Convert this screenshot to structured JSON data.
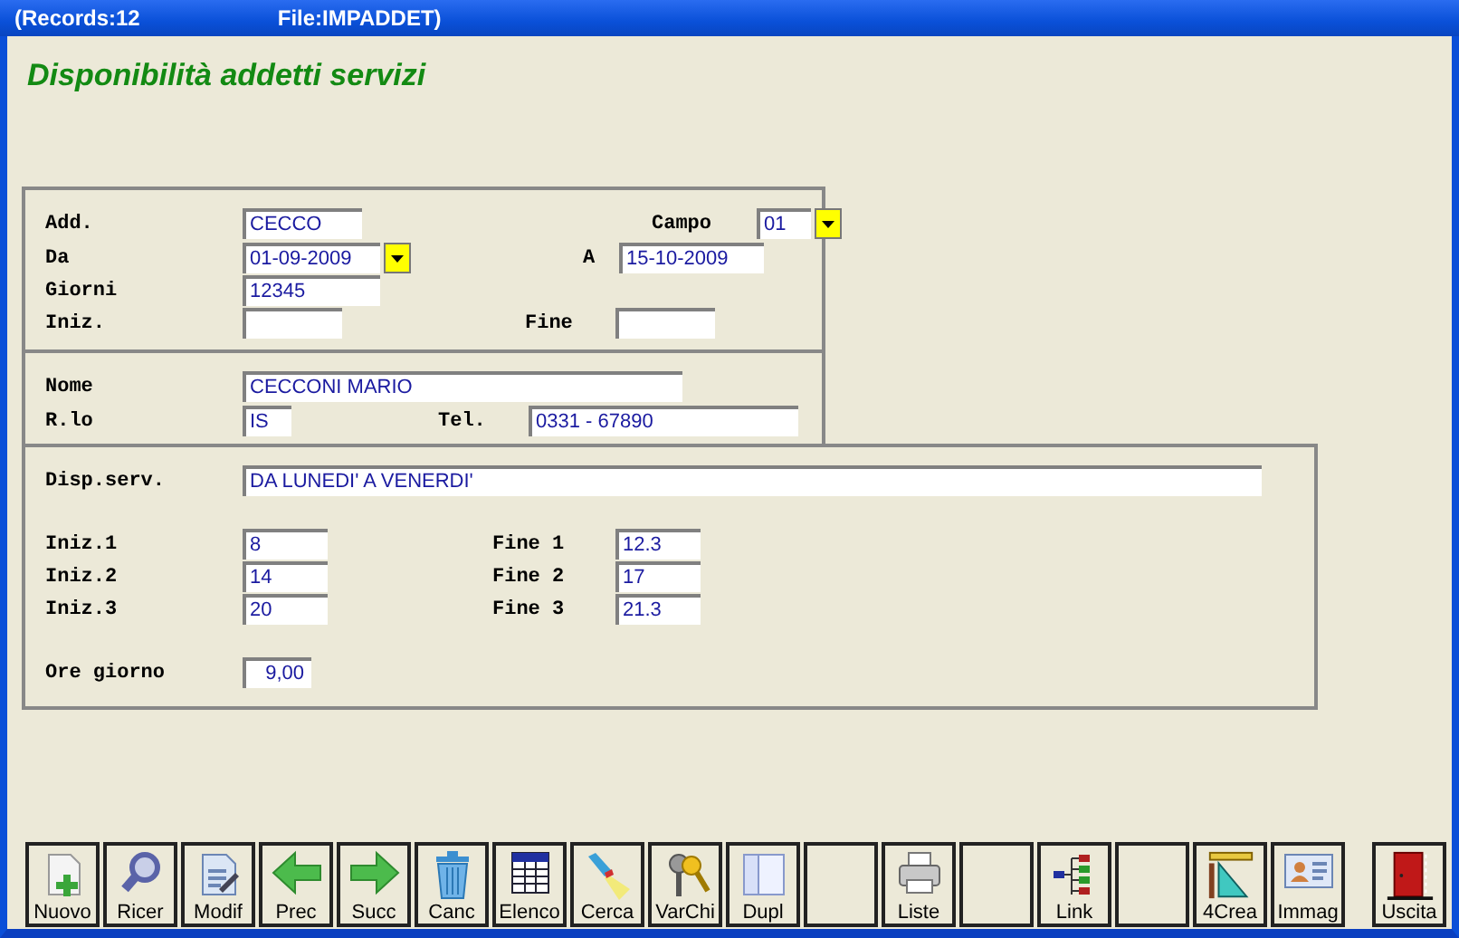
{
  "title_bar": {
    "records": "(Records:12",
    "file": "File:IMPADDET)"
  },
  "form_title": "Disponibilità addetti servizi",
  "panels": [
    {
      "rows": [
        [
          {
            "label": "Add.",
            "value": "CECCO",
            "dropdown": false
          },
          {
            "label": "Campo",
            "value": "01",
            "dropdown": true
          }
        ],
        [
          {
            "label": "Da",
            "value": "01-09-2009",
            "dropdown": true
          },
          {
            "label": "A",
            "value": "15-10-2009",
            "dropdown": false
          }
        ],
        [
          {
            "label": "Giorni",
            "value": "12345",
            "dropdown": false
          }
        ],
        [
          {
            "label": "Iniz.",
            "dropdown": false
          },
          {
            "label": "Fine",
            "dropdown": false
          }
        ]
      ]
    },
    {
      "rows": [
        [
          {
            "label": "Nome",
            "value": "CECCONI MARIO",
            "dropdown": false
          }
        ],
        [
          {
            "label": "R.lo",
            "value": "IS",
            "dropdown": false
          },
          {
            "label": "Tel.",
            "value": "0331 - 67890",
            "dropdown": false
          }
        ]
      ]
    },
    {
      "rows": [
        [
          {
            "label": "Disp.serv.",
            "value": "DA LUNEDI' A VENERDI'",
            "dropdown": false
          }
        ],
        [
          {
            "label": "Iniz.1",
            "value": "8",
            "dropdown": false
          },
          {
            "label": "Fine 1",
            "value": "12.3",
            "dropdown": false
          }
        ],
        [
          {
            "label": "Iniz.2",
            "value": "14",
            "dropdown": false
          },
          {
            "label": "Fine 2",
            "value": "17",
            "dropdown": false
          }
        ],
        [
          {
            "label": "Iniz.3",
            "value": "20",
            "dropdown": false
          },
          {
            "label": "Fine 3",
            "value": "21.3",
            "dropdown": false
          }
        ],
        [
          {
            "label": "Ore giorno",
            "value": "9,00",
            "dropdown": false
          }
        ]
      ]
    }
  ],
  "toolbar": [
    {
      "kind": "button",
      "label": "Nuovo"
    },
    {
      "kind": "button",
      "label": "Ricer"
    },
    {
      "kind": "button",
      "label": "Modif"
    },
    {
      "kind": "button",
      "label": "Prec"
    },
    {
      "kind": "button",
      "label": "Succ"
    },
    {
      "kind": "button",
      "label": "Canc"
    },
    {
      "kind": "button",
      "label": "Elenco"
    },
    {
      "kind": "button",
      "label": "Cerca"
    },
    {
      "kind": "button",
      "label": "VarChi"
    },
    {
      "kind": "button",
      "label": "Dupl"
    },
    {
      "kind": "blank"
    },
    {
      "kind": "button",
      "label": "Liste"
    },
    {
      "kind": "blank"
    },
    {
      "kind": "button",
      "label": "Link"
    },
    {
      "kind": "blank"
    },
    {
      "kind": "button",
      "label": "4Crea"
    },
    {
      "kind": "button",
      "label": "Immag"
    },
    {
      "kind": "button",
      "label": "Uscita"
    }
  ]
}
